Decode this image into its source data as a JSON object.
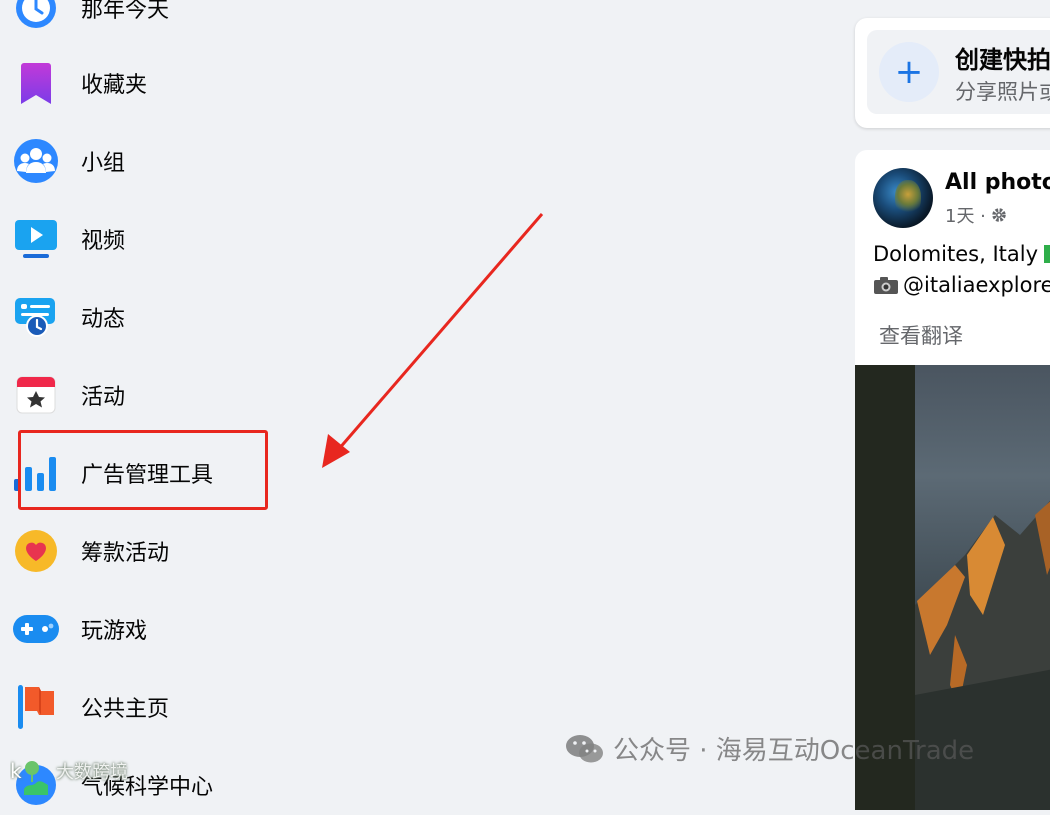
{
  "sidebar": {
    "items": [
      {
        "label": "那年今天",
        "icon": "memories-clock-icon"
      },
      {
        "label": "收藏夹",
        "icon": "saved-bookmark-icon"
      },
      {
        "label": "小组",
        "icon": "groups-icon"
      },
      {
        "label": "视频",
        "icon": "video-play-icon"
      },
      {
        "label": "动态",
        "icon": "feeds-icon"
      },
      {
        "label": "活动",
        "icon": "events-calendar-icon"
      },
      {
        "label": "广告管理工具",
        "icon": "ads-manager-bar-chart-icon"
      },
      {
        "label": "筹款活动",
        "icon": "fundraiser-heart-icon"
      },
      {
        "label": "玩游戏",
        "icon": "gaming-controller-icon"
      },
      {
        "label": "公共主页",
        "icon": "pages-flag-icon"
      },
      {
        "label": "气候科学中心",
        "icon": "climate-center-icon"
      }
    ]
  },
  "create": {
    "title": "创建快拍",
    "subtitle": "分享照片或",
    "icon": "plus-icon"
  },
  "post": {
    "author": "All photos",
    "time": "1天 · ",
    "text_line1": "Dolomites, Italy",
    "text_line2": "@italiaexplore",
    "translate": "查看翻译"
  },
  "watermarks": {
    "main": "公众号 · 海易互动OceanTrade",
    "corner": "大数跨境"
  },
  "colors": {
    "background": "#f0f2f5",
    "accent": "#1b74e4",
    "highlight": "#e8271f"
  }
}
